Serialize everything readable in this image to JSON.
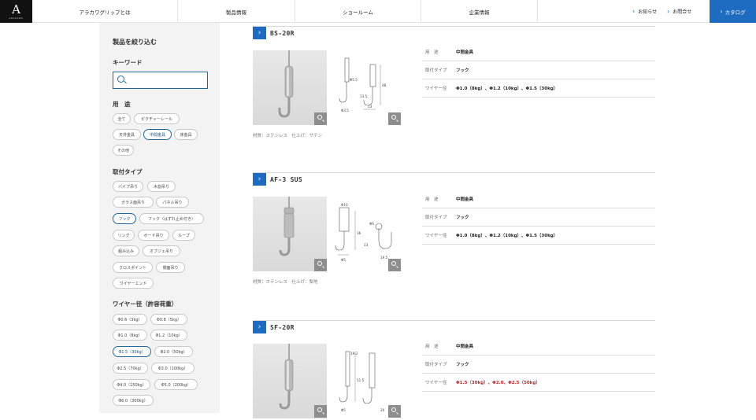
{
  "header": {
    "logo_mark": "A",
    "logo_word": "ARAKAWA",
    "nav": [
      "アラカワグリップとは",
      "製品情報",
      "ショールーム",
      "企業情報"
    ],
    "utility": [
      "お知らせ",
      "お問合せ"
    ],
    "catalog_label": "カタログ",
    "accent_color": "#1e6cc1"
  },
  "sidebar": {
    "title": "製品を絞り込む",
    "keyword_heading": "キーワード",
    "search_placeholder": "",
    "use_heading": "用　途",
    "use_chips": [
      "全て",
      "ピクチャーレール",
      "天井金具",
      "中間金具",
      "床金具",
      "その他"
    ],
    "use_selected": "中間金具",
    "mount_heading": "取付タイプ",
    "mount_chips": [
      "パイプ吊り",
      "木割吊り",
      "ガラス面吊り",
      "パネル吊り",
      "フック",
      "フック（はずれ止め付き）",
      "リング",
      "ボード吊り",
      "ループ",
      "組み込み",
      "オブジェ吊り",
      "クロスポイント",
      "側面吊り",
      "ワイヤーエンド"
    ],
    "mount_selected": "フック",
    "wire_heading": "ワイヤー径（許容荷重）",
    "wire_chips": [
      "Φ0.6（3kg）",
      "Φ0.8（5kg）",
      "Φ1.0（8kg）",
      "Φ1.2（10kg）",
      "Φ1.5（30kg）",
      "Φ2.0（50kg）",
      "Φ2.5（70kg）",
      "Φ3.0（100kg）",
      "Φ4.0（150kg）",
      "Φ5.0（200kg）",
      "Φ6.0（300kg）"
    ],
    "wire_selected": "Φ1.5（30kg）"
  },
  "products": [
    {
      "name": "BS-20R",
      "material": "材質：ステンレス　仕上げ：サテン",
      "specs": [
        {
          "label": "用　途",
          "value": "中間金具"
        },
        {
          "label": "取付タイプ",
          "value": "フック"
        },
        {
          "label": "ワイヤー径",
          "value": "Φ1.0（8kg）、Φ1.2（10kg）、Φ1.5（30kg）",
          "highlight": false
        }
      ],
      "dims": [
        "Φ5.5",
        "48",
        "13.5",
        "13",
        "Φ3.5"
      ]
    },
    {
      "name": "AF-3 SUS",
      "material": "材質：ステンレス　仕上げ：梨地",
      "specs": [
        {
          "label": "用　途",
          "value": "中間金具"
        },
        {
          "label": "取付タイプ",
          "value": "フック"
        },
        {
          "label": "ワイヤー径",
          "value": "Φ1.0（8kg）、Φ1.2（10kg）、Φ1.5（30kg）",
          "highlight": false
        }
      ],
      "dims": [
        "Φ10",
        "Φ6",
        "36",
        "13",
        "19.5",
        "Φ5"
      ]
    },
    {
      "name": "SF-20R",
      "material": "",
      "specs": [
        {
          "label": "用　途",
          "value": "中間金具"
        },
        {
          "label": "取付タイプ",
          "value": "フック"
        },
        {
          "label": "ワイヤー径",
          "value": "Φ1.5（30kg）、Φ2.0、Φ2.5（50kg）",
          "highlight": true
        }
      ],
      "dims": [
        "19.2",
        "51.5",
        "20",
        "Φ5"
      ]
    }
  ]
}
